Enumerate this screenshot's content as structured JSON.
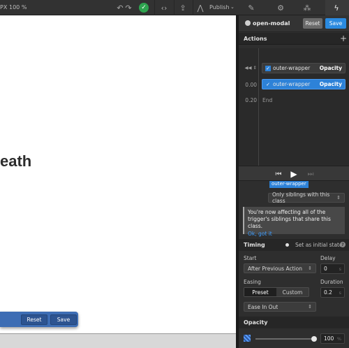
{
  "topbar": {
    "width_unit": "PX",
    "zoom": "100 %",
    "publish_label": "Publish",
    "icons": [
      "undo-icon",
      "redo-icon",
      "status-check-icon",
      "code-icon",
      "export-icon",
      "publish-icon",
      "brush-icon",
      "gear-icon",
      "drops-icon",
      "lightning-icon"
    ]
  },
  "canvas": {
    "heading_fragment": "eath",
    "floating_bar": {
      "reset_label": "Reset",
      "save_label": "Save"
    }
  },
  "panel": {
    "header": {
      "title": "open-modal",
      "reset_label": "Reset",
      "save_label": "Save"
    },
    "actions": {
      "title": "Actions",
      "rows": [
        {
          "time": "",
          "name": "outer-wrapper",
          "type": "Opacity",
          "active": false
        },
        {
          "time": "0.00",
          "name": "outer-wrapper",
          "type": "Opacity",
          "active": true
        }
      ],
      "end": {
        "time": "0.20",
        "label": "End"
      }
    },
    "selector": {
      "chip": "outer-wrapper",
      "scope": "Only siblings with this class"
    },
    "info": {
      "message": "You're now affecting all of the trigger's siblings that share this class.",
      "link": "Ok, got it"
    },
    "timing": {
      "title": "Timing",
      "initial_state_label": "Set as initial state",
      "start_label": "Start",
      "start_value": "After Previous Action",
      "delay_label": "Delay",
      "delay_value": "0",
      "delay_unit": "s",
      "easing_label": "Easing",
      "easing_preset": "Preset",
      "easing_custom": "Custom",
      "duration_label": "Duration",
      "duration_value": "0.2",
      "duration_unit": "s",
      "easing_value": "Ease In Out"
    },
    "opacity": {
      "title": "Opacity",
      "value": "100",
      "unit": "%",
      "level": 1.0
    }
  },
  "colors": {
    "accent": "#2d82d8",
    "save": "#2a8ae0",
    "status_ok": "#2ea44f",
    "floatbar": "#3d6db4"
  }
}
